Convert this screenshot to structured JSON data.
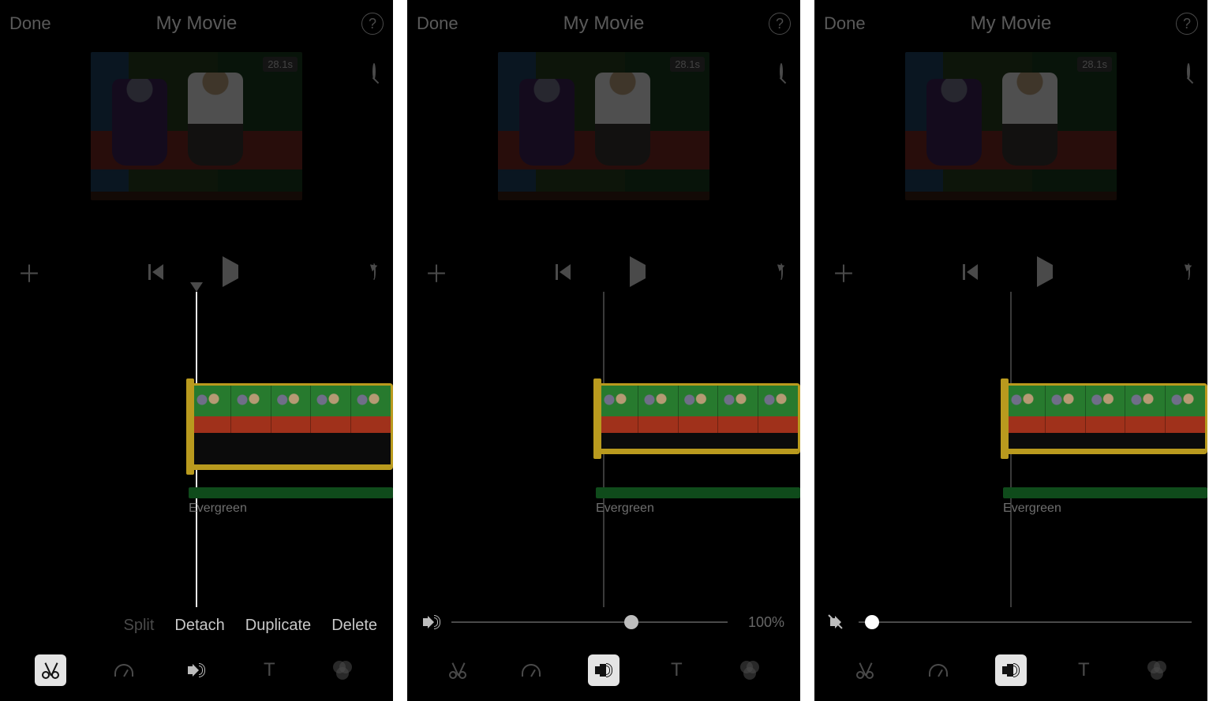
{
  "header": {
    "done": "Done",
    "title": "My Movie",
    "help_glyph": "?"
  },
  "preview": {
    "duration_badge": "28.1s"
  },
  "timeline": {
    "audio_track_label": "Evergreen"
  },
  "screen1": {
    "actions": {
      "split": "Split",
      "detach": "Detach",
      "duplicate": "Duplicate",
      "delete": "Delete"
    },
    "active_tool": "cut"
  },
  "screen2": {
    "volume_percent_label": "100%",
    "knob_pct": 65,
    "muted": false,
    "active_tool": "volume"
  },
  "screen3": {
    "knob_pct": 4,
    "muted": true,
    "active_tool": "volume"
  }
}
